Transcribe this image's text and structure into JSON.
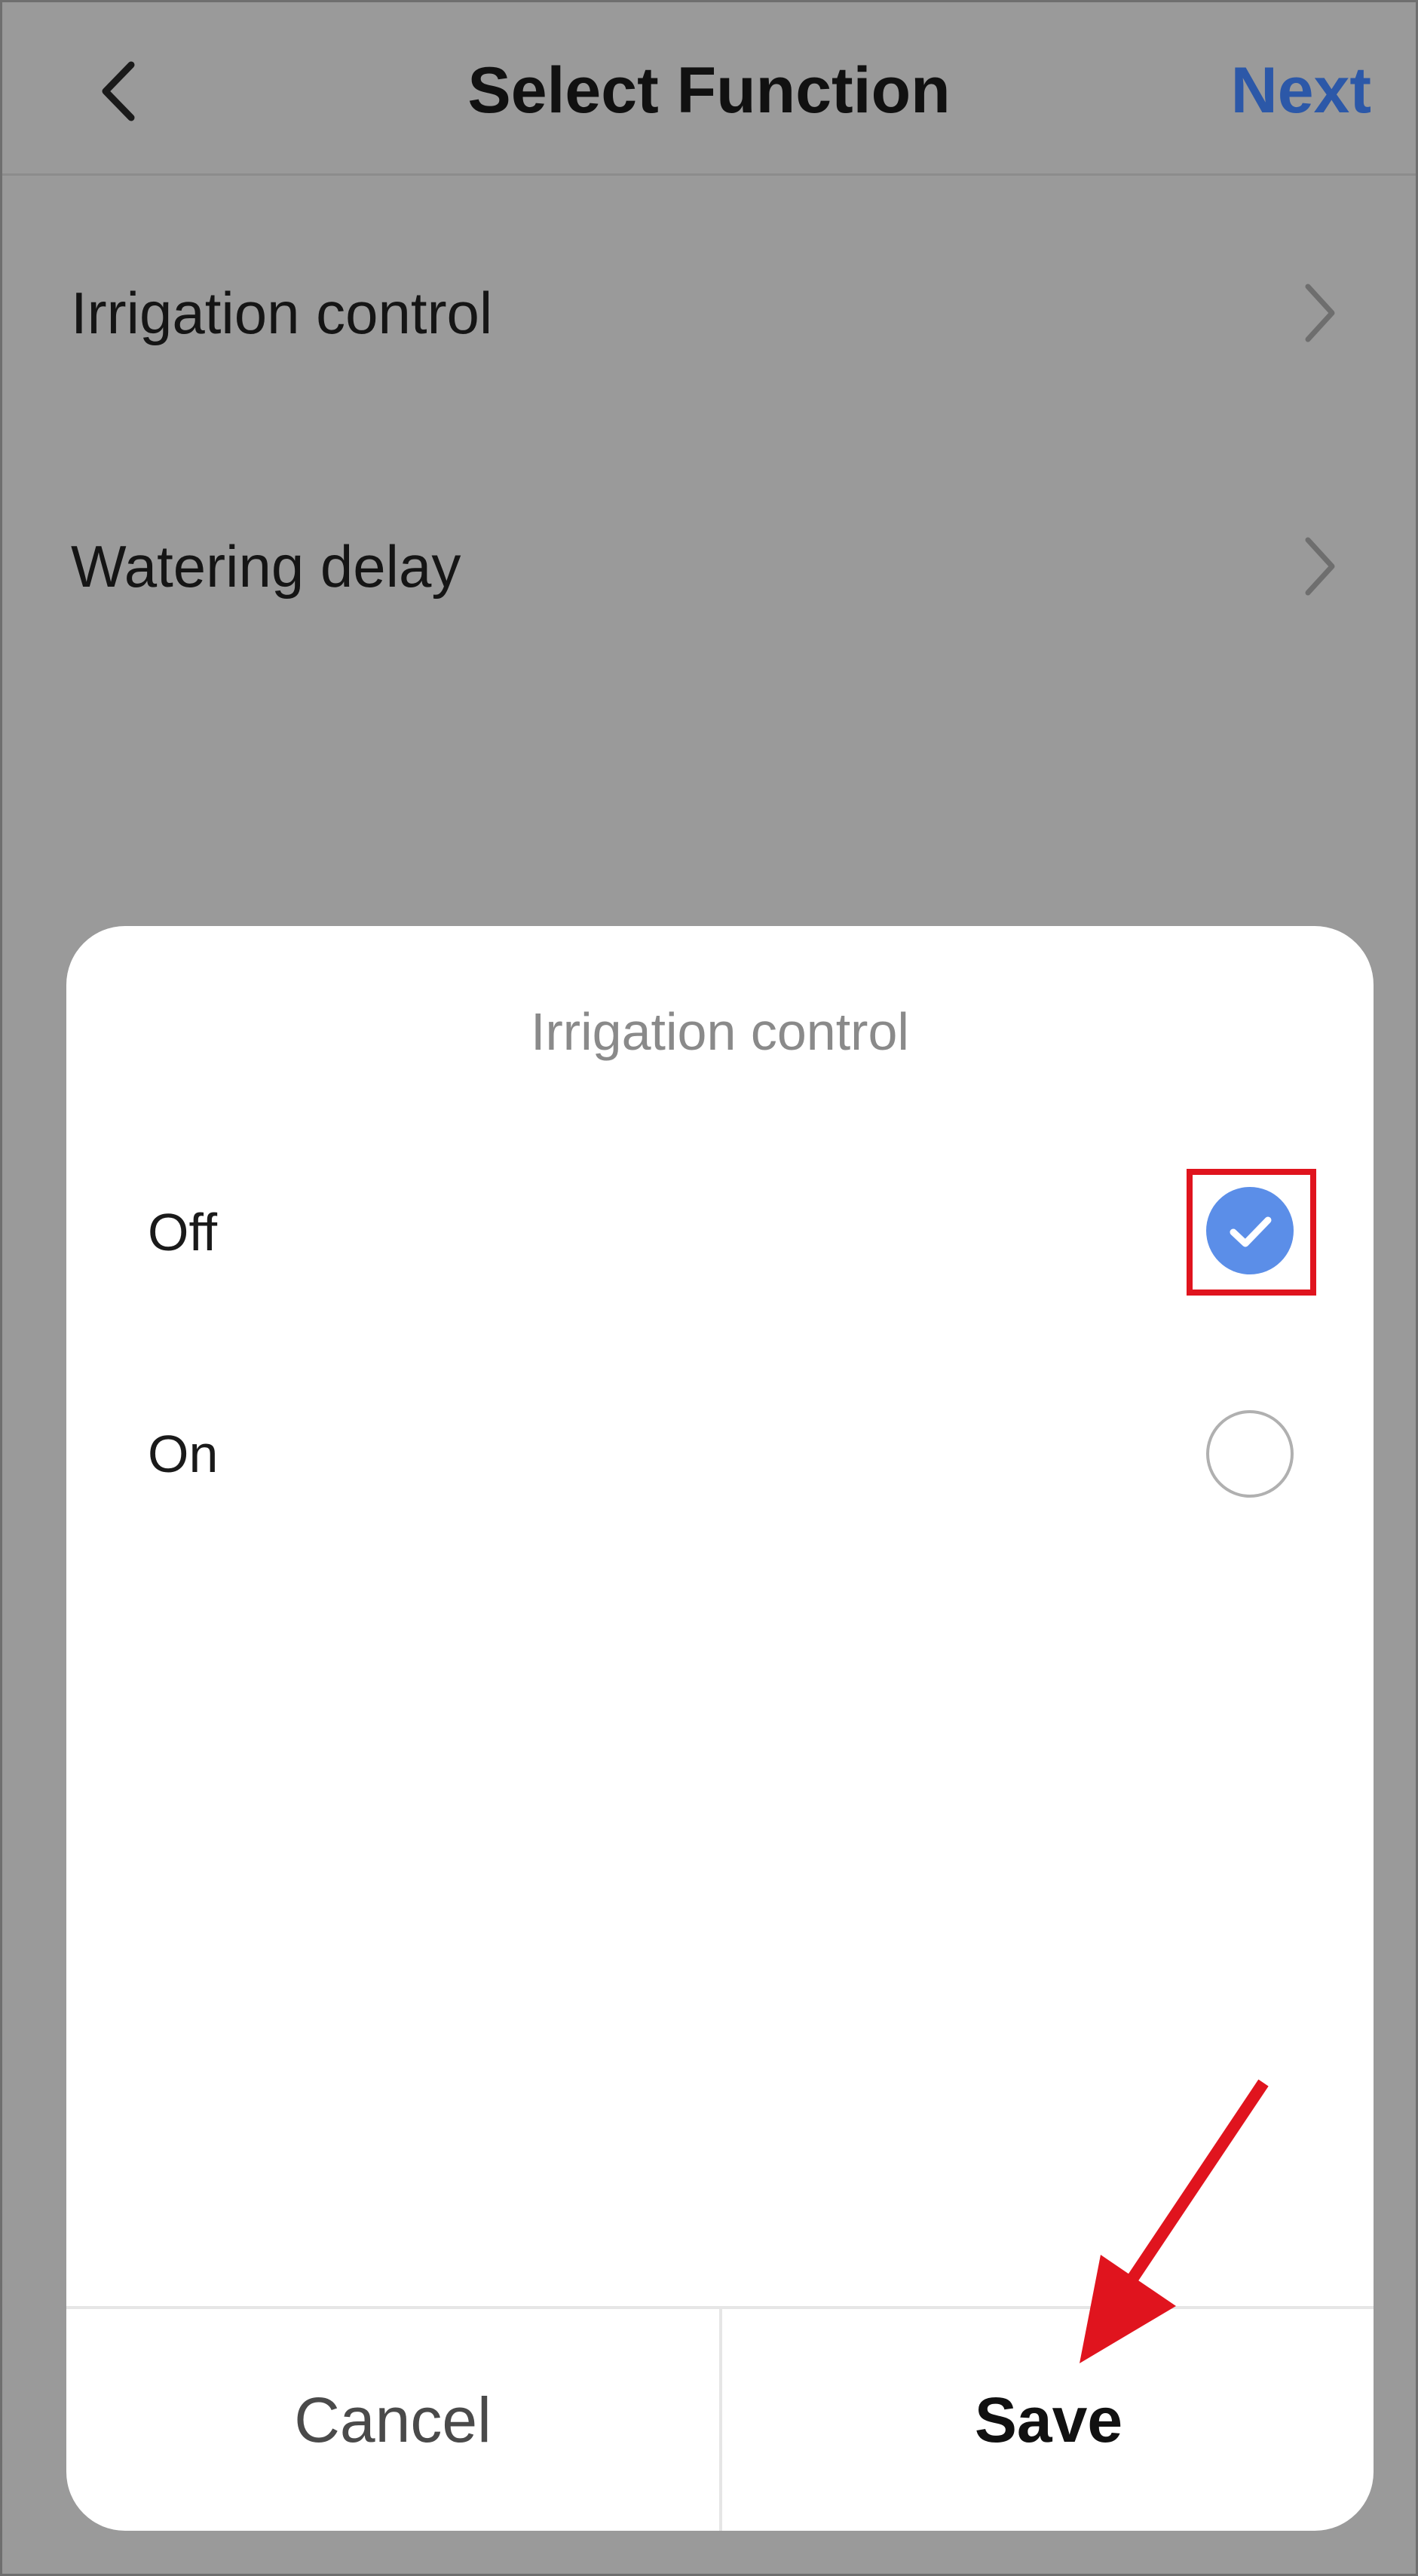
{
  "header": {
    "title": "Select Function",
    "back_icon": "chevron-left-icon",
    "next_label": "Next",
    "next_color": "#2c58a8"
  },
  "list": {
    "items": [
      {
        "label": "Irrigation control",
        "icon": "chevron-right-icon"
      },
      {
        "label": "Watering delay",
        "icon": "chevron-right-icon"
      }
    ]
  },
  "dialog": {
    "title": "Irrigation control",
    "options": [
      {
        "label": "Off",
        "selected": true
      },
      {
        "label": "On",
        "selected": false
      }
    ],
    "cancel_label": "Cancel",
    "save_label": "Save",
    "accent_color": "#5b8ee8"
  },
  "annotations": {
    "highlight_color": "#e0141e",
    "arrow_color": "#e0141e"
  }
}
